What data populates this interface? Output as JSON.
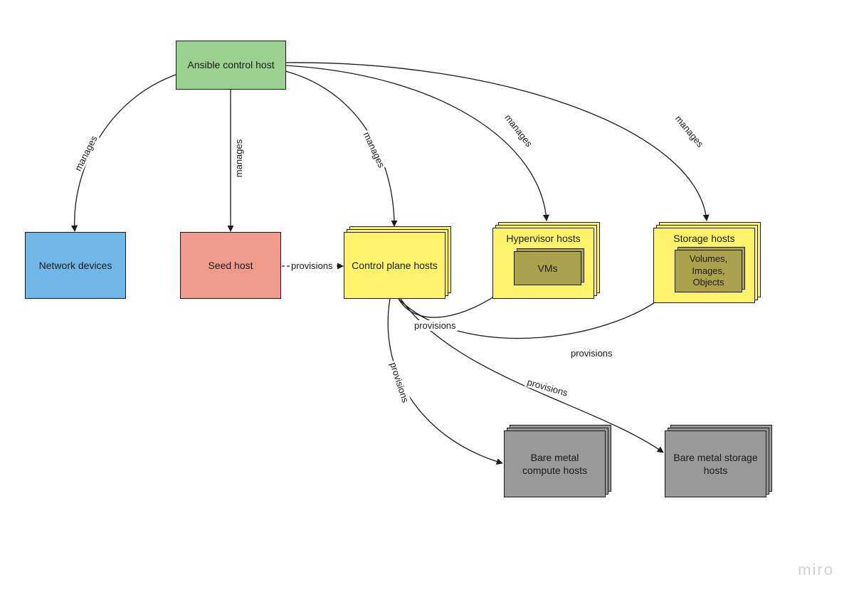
{
  "nodes": {
    "ansible": {
      "label": "Ansible control host"
    },
    "network_devices": {
      "label": "Network devices"
    },
    "seed_host": {
      "label": "Seed host"
    },
    "control_plane": {
      "label": "Control plane hosts"
    },
    "hypervisor_hosts": {
      "label": "Hypervisor hosts"
    },
    "vms": {
      "label": "VMs"
    },
    "storage_hosts": {
      "label": "Storage hosts"
    },
    "volumes": {
      "label": "Volumes, Images, Objects"
    },
    "bm_compute": {
      "label": "Bare metal compute hosts"
    },
    "bm_storage": {
      "label": "Bare metal storage hosts"
    }
  },
  "edges": {
    "manages": "manages",
    "provisions": "provisions"
  },
  "branding": "miro",
  "colors": {
    "green": "#99d18f",
    "blue": "#6fb7e7",
    "red": "#ef9a8c",
    "yellow": "#fff36b",
    "olive": "#aca24e",
    "gray": "#999999"
  }
}
